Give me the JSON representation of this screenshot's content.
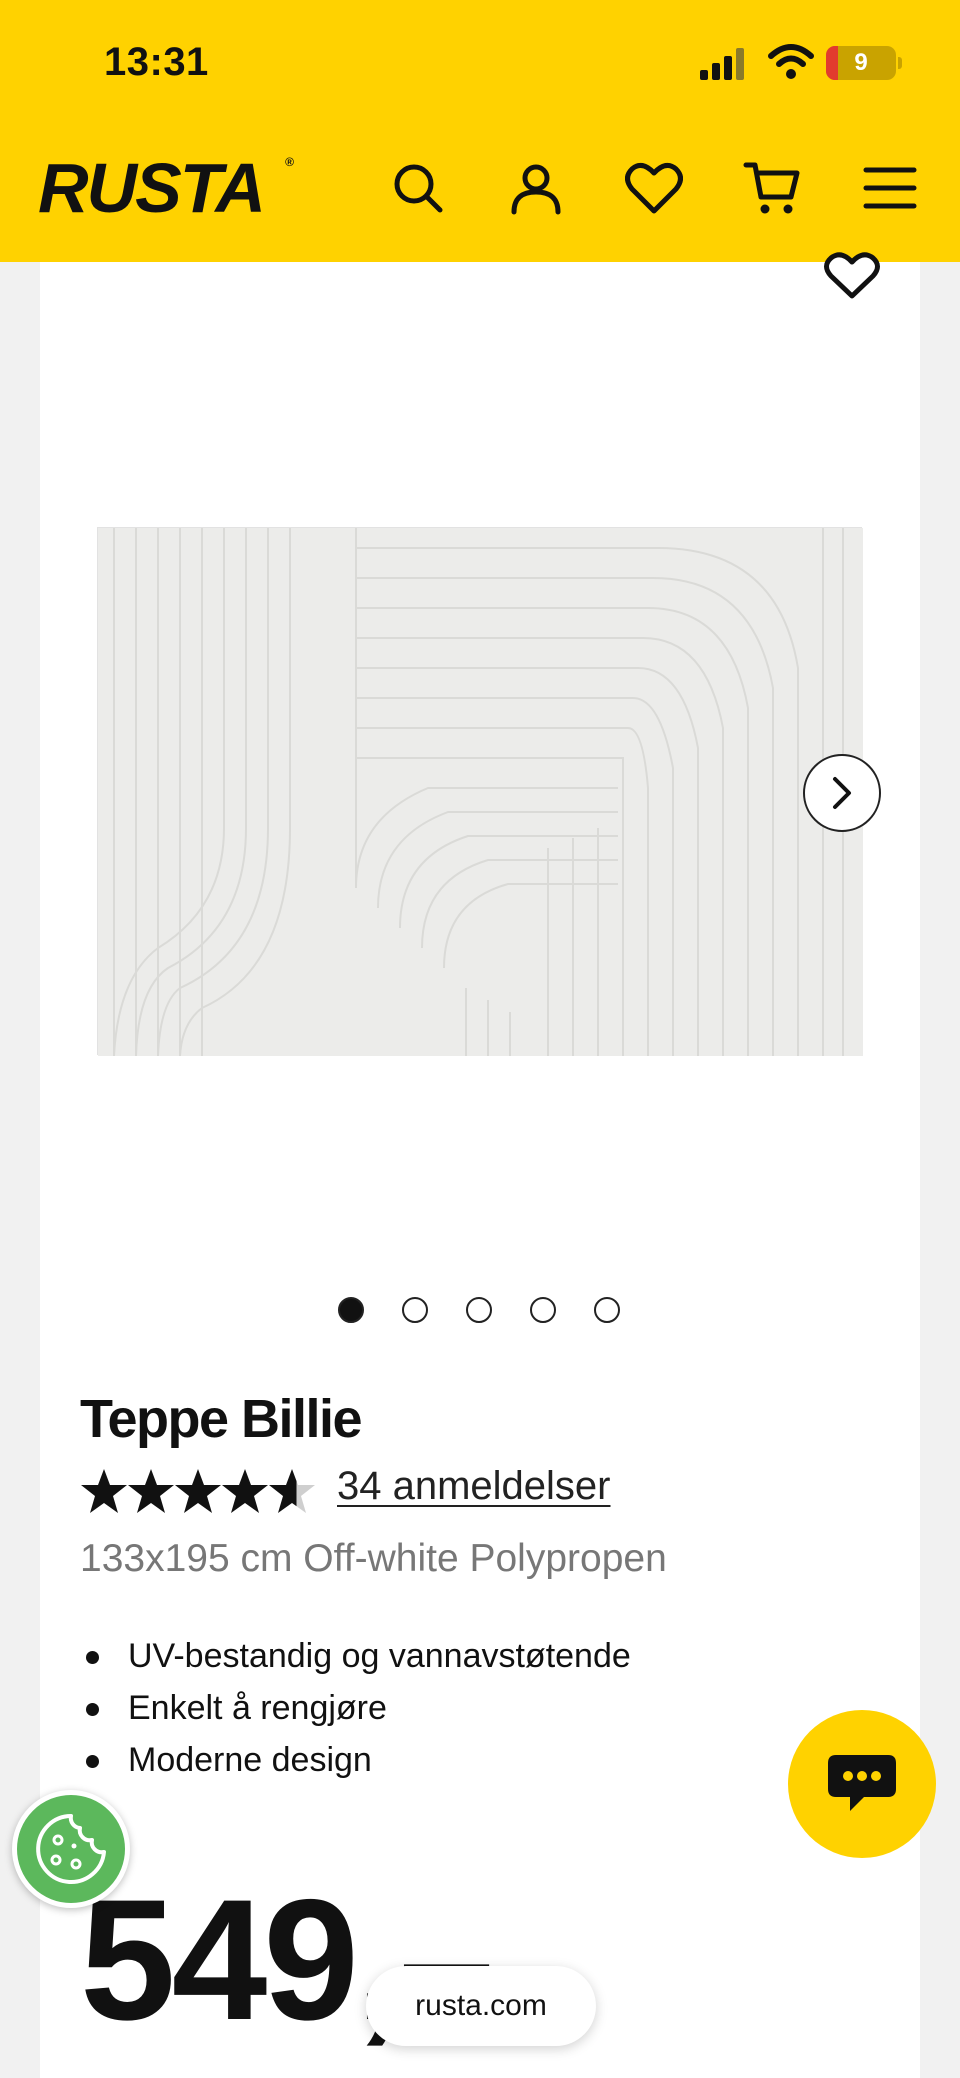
{
  "status_bar": {
    "time": "13:31",
    "battery": "9"
  },
  "header": {
    "logo": "RUSTA",
    "logo_mark": "®",
    "icons": [
      "search-icon",
      "user-icon",
      "heart-icon",
      "cart-icon",
      "menu-icon"
    ],
    "brand_color": "#ffd200"
  },
  "product": {
    "name": "Teppe Billie",
    "rating": 4.6,
    "stars_max": 5,
    "reviews_label": "34 anmeldelser",
    "subtitle": "133x195 cm Off-white Polypropen",
    "features": [
      "UV-bestandig og vannavstøtende",
      "Enkelt å rengjøre",
      "Moderne design"
    ],
    "price": "549,–"
  },
  "gallery": {
    "image_count": 5,
    "active_index": 0
  },
  "browser": {
    "url": "rusta.com"
  }
}
